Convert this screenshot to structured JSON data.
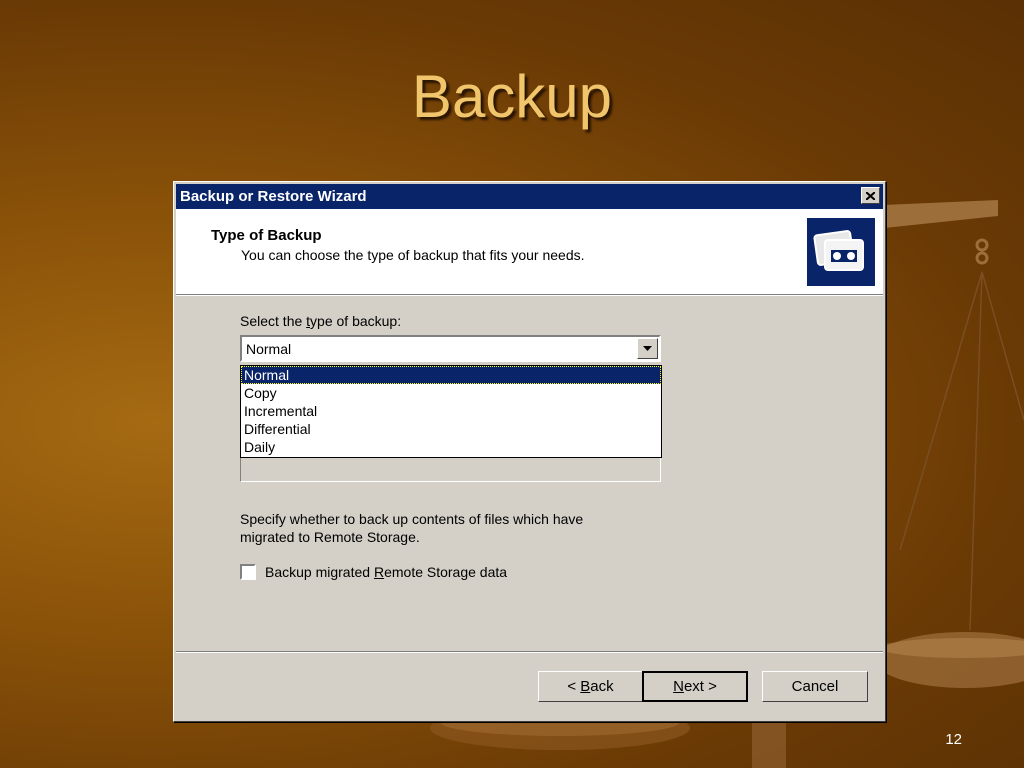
{
  "slide": {
    "title": "Backup",
    "page_number": "12"
  },
  "window": {
    "title": "Backup or Restore Wizard",
    "close_label": "×"
  },
  "header": {
    "title": "Type of Backup",
    "subtitle": "You can choose the type of backup that fits your needs.",
    "icon": "backup-tape-icon"
  },
  "type_select": {
    "label_pre": "Select the ",
    "label_mnemonic": "t",
    "label_post": "ype of backup:",
    "value": "Normal",
    "options": [
      "Normal",
      "Copy",
      "Incremental",
      "Differential",
      "Daily"
    ],
    "selected_index": 0
  },
  "remote_storage": {
    "description_line1": "Specify whether to back up contents of files which have",
    "description_line2": "migrated to Remote Storage.",
    "checkbox_label_pre": "Backup migrated ",
    "checkbox_label_mnemonic": "R",
    "checkbox_label_post": "emote Storage data",
    "checked": false
  },
  "buttons": {
    "back_prefix": "< ",
    "back_mnemonic": "B",
    "back_rest": "ack",
    "next_mnemonic": "N",
    "next_rest": "ext",
    "next_suffix": " >",
    "cancel": "Cancel"
  },
  "colors": {
    "titlebar": "#0a246a",
    "dialog_face": "#d4d0c8",
    "slide_title": "#f0c56c",
    "background": "#8a5209"
  }
}
